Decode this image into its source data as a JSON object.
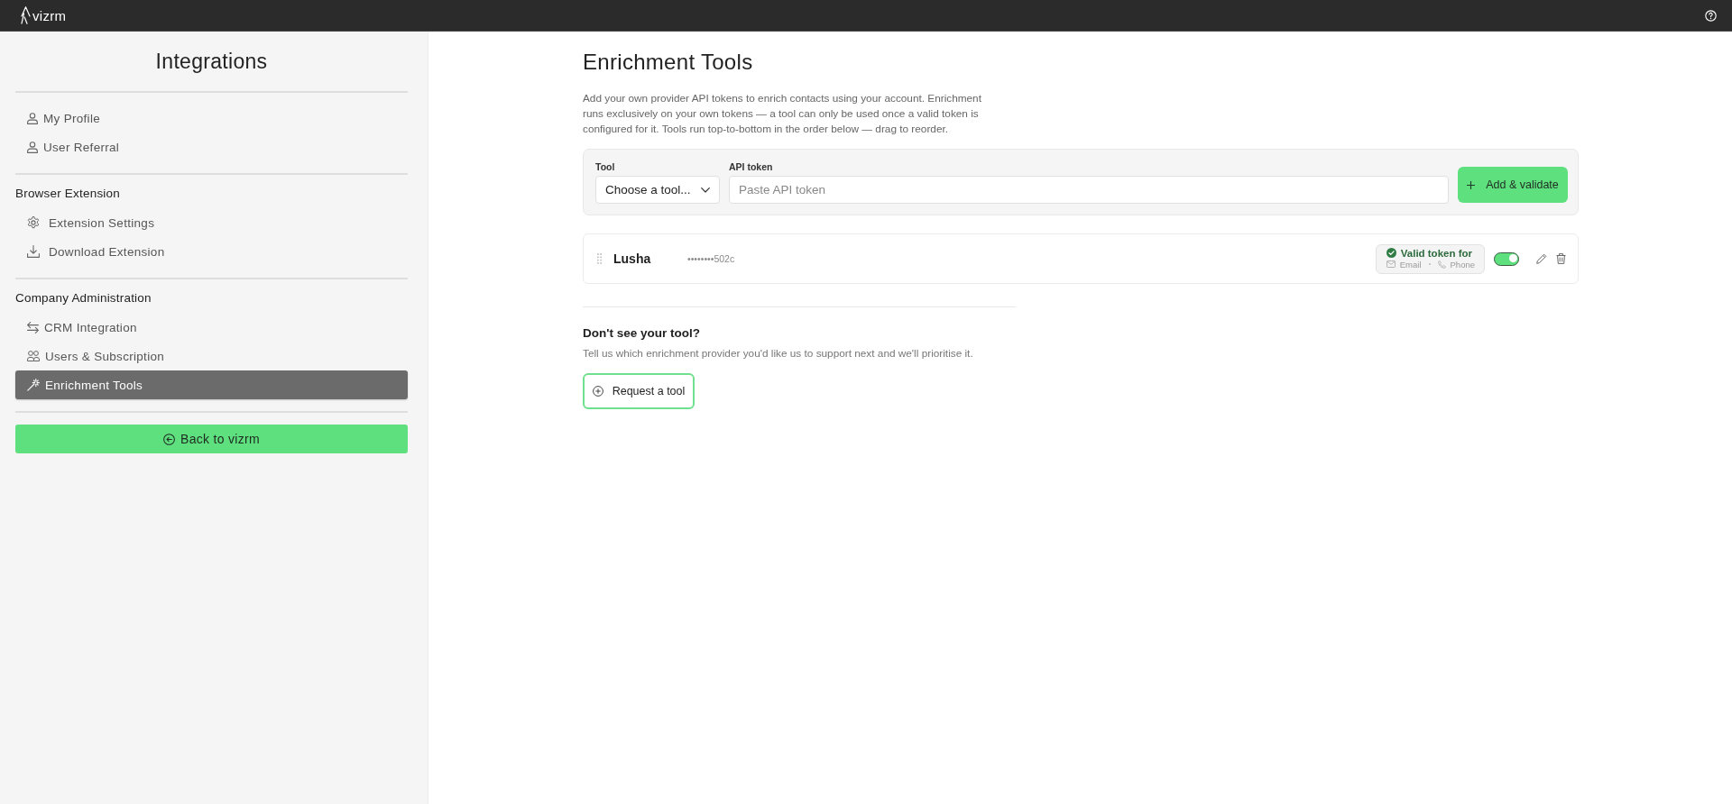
{
  "top_bar": {
    "logo_text": "vizrm"
  },
  "sidebar": {
    "title": "Integrations",
    "sections": [
      {
        "items": [
          {
            "label": "My Profile",
            "selected": false
          },
          {
            "label": "User Referral",
            "selected": false
          }
        ]
      },
      {
        "heading": "Browser Extension",
        "items": [
          {
            "label": "Extension Settings",
            "selected": false
          },
          {
            "label": "Download Extension",
            "selected": false
          }
        ]
      },
      {
        "heading": "Company Administration",
        "items": [
          {
            "label": "CRM Integration",
            "selected": false
          },
          {
            "label": "Users & Subscription",
            "selected": false
          },
          {
            "label": "Enrichment Tools",
            "selected": true
          }
        ]
      }
    ],
    "back_button": "Back to vizrm"
  },
  "main": {
    "title": "Enrichment Tools",
    "description": "Add your own provider API tokens to enrich contacts using your account. Enrichment runs exclusively on your own tokens — a tool can only be used once a valid token is configured for it. Tools run top-to-bottom in the order below — drag to reorder.",
    "add_form": {
      "tool_label": "Tool",
      "tool_value": "Choose a tool...",
      "token_label": "API token",
      "token_placeholder": "Paste API token",
      "submit_button": "Add & validate"
    },
    "tools": [
      {
        "name": "Lusha",
        "token": "••••••••502c",
        "valid": true,
        "status": "Valid token for",
        "capabilities": [
          "Email",
          "Phone"
        ],
        "enabled": true
      }
    ],
    "request": {
      "heading": "Don't see your tool?",
      "text": "Tell us which enrichment provider you'd like us to support next and we'll prioritise it.",
      "button": "Request a tool"
    }
  }
}
